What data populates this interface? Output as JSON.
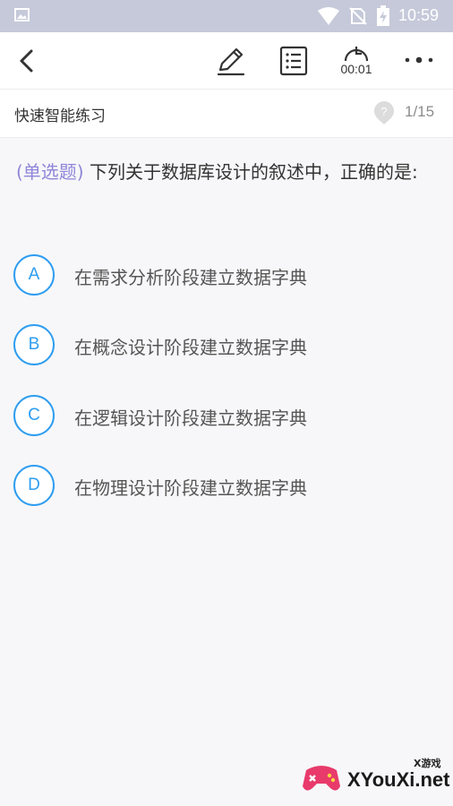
{
  "status_bar": {
    "time": "10:59",
    "icons": [
      "image-icon",
      "wifi-icon",
      "no-sim-icon",
      "battery-charging-icon"
    ]
  },
  "toolbar": {
    "timer": "00:01",
    "icons": [
      "back-icon",
      "edit-icon",
      "list-icon",
      "timer-icon",
      "more-icon"
    ]
  },
  "header": {
    "title": "快速智能练习",
    "progress": "1/15"
  },
  "question": {
    "type": "(单选题)",
    "text": "下列关于数据库设计的叙述中，正确的是:"
  },
  "options": [
    {
      "letter": "A",
      "text": "在需求分析阶段建立数据字典"
    },
    {
      "letter": "B",
      "text": "在概念设计阶段建立数据字典"
    },
    {
      "letter": "C",
      "text": "在逻辑设计阶段建立数据字典"
    },
    {
      "letter": "D",
      "text": "在物理设计阶段建立数据字典"
    }
  ],
  "colors": {
    "accent": "#2e9df0",
    "question_type": "#8f86d8",
    "status_bar": "#c5c9d9"
  },
  "watermark": {
    "sub": "X游戏",
    "main": "XYouXi.net"
  }
}
